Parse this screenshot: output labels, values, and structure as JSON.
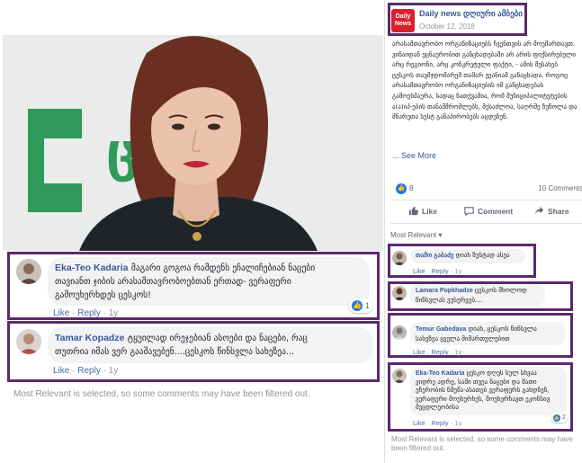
{
  "colors": {
    "link_blue": "#385898",
    "highlight_purple": "#5b2a6b",
    "like_blue": "#1877f2",
    "bubble_gray": "#f2f3f5",
    "muted_gray": "#90949c",
    "logo_green": "#2f9a5a",
    "brand_red": "#d8202e"
  },
  "photo": {
    "logo_text": "ცეს"
  },
  "left_comments": [
    {
      "author": "Eka-Teo Kadaria",
      "text_line1": "მაგარი გოგოა რამდენს ეჩალიჩებიან ნაცები",
      "text_line2": "თავიანთ ჯიბის არასამთავრობოებთან ერთად- ვერაფერი",
      "text_line3": "გამოუხერხდეს ცესკოს!",
      "like": "Like",
      "reply": "Reply",
      "time": "1y",
      "reactions": "1"
    },
    {
      "author": "Tamar Kopadze",
      "text_line1": "ტყუილად ირეჯებიან ასოები და ნაცები, რაც",
      "text_line2": "თუთრია იმას ვერ გააშავებენ....ცესკოს წინსვლა სახეზეა...",
      "like": "Like",
      "reply": "Reply",
      "time": "1y"
    }
  ],
  "left_notice": "Most Relevant is selected, so some comments may have been filtered out.",
  "post": {
    "logo_line1": "Daily",
    "logo_line2": "News",
    "page_name": "Daily news დღიური ამბები",
    "date": "October 12, 2018",
    "text": "არასამთავრობო ორგანიზაციებს ჩვენთვის არ მოუმართავთ. ვინაიდან უცნაურობით განცხადებაში არ არის ფიქსირებული არც რეგიონი, არც კონკრეტული ფაქტი, - ამის შესახებ ცესკოს თავმჯდომარემ თამარ ჟვანიამ განაცხადა. როგოც არასამთავრობო ორგანიზაციების იმ განცხადებას გამოეხმაურა, სადაც ნათქვამია, რომ მუნიციპალიტეტების ა(ა)იპ-ების თანამშრომლებს, მესაძლოა, საღრმე ზეწოლა და მნარეთა სუსტ განაპირობებს აცდენენ.",
    "see_more": "... See More",
    "likes_count": "8",
    "comments_count": "10 Comments",
    "like_label": "Like",
    "comment_label": "Comment",
    "share_label": "Share",
    "most_relevant": "Most Relevant ▾"
  },
  "right_comments": [
    {
      "author": "თამო გაბაძე",
      "text": "დიახ ზუსტად ასეა",
      "like": "Like",
      "reply": "Reply",
      "time": "1y"
    },
    {
      "author": "Lamara Popkhadze",
      "text_line1": "ცესკოს მხოლოდ",
      "text_line2": "წინსვლას ვუსურვებ....",
      "like": "Like",
      "reply": "Reply",
      "time": "1y"
    },
    {
      "author": "Temur Gabedava",
      "text_line1": "დიახ, ცესკოს წინსვლა",
      "text_line2": "სახეზეა ყველა მიმართულებით",
      "like": "Like",
      "reply": "Reply",
      "time": "1y"
    },
    {
      "author": "Eka-Teo Kadaria",
      "text_line1": "ცესკო დღეს სულ სხვაა",
      "text_line2": "ვიდრე ადრე, სამი თვეა ნაცები და მათი",
      "text_line3": "ეჩერობის ნმუშა-ასათებ ვერაფერს გახდნენ,",
      "text_line4": "ვერაფერი მოუხერხეს, მოუხერხავთ ეკონსივ",
      "text_line5": "მეცდლეობისა",
      "like": "Like",
      "reply": "Reply",
      "time": "1y",
      "reactions": "2"
    }
  ],
  "right_notice": "Most Relevant is selected, so some comments may have been filtered out."
}
